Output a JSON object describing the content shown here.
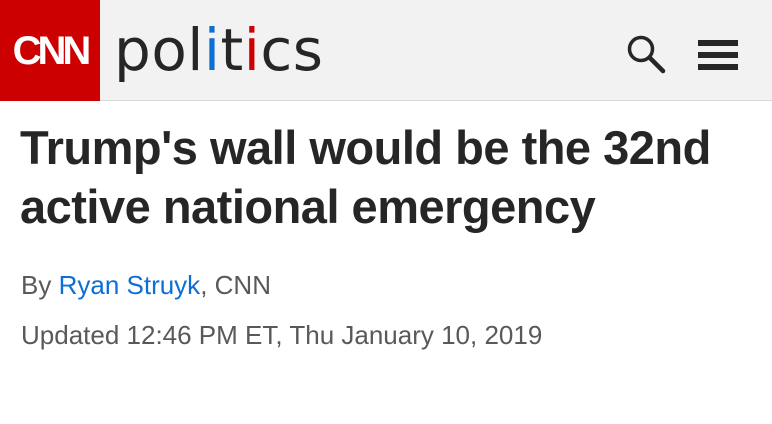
{
  "header": {
    "logo_text": "CNN",
    "section_parts": [
      "pol",
      "i",
      "t",
      "i",
      "cs"
    ],
    "search_icon": "search-icon",
    "menu_icon": "hamburger-menu-icon",
    "colors": {
      "logo_bg": "#cc0000",
      "accent_blue": "#0c6fd6",
      "accent_red": "#cc0000",
      "bar_bg": "#f2f2f2"
    }
  },
  "article": {
    "headline": "Trump's wall would be the 32nd active national emergency",
    "byline_prefix": "By ",
    "author": "Ryan Struyk",
    "byline_suffix": ", CNN",
    "updated": "Updated 12:46 PM ET, Thu January 10, 2019"
  }
}
